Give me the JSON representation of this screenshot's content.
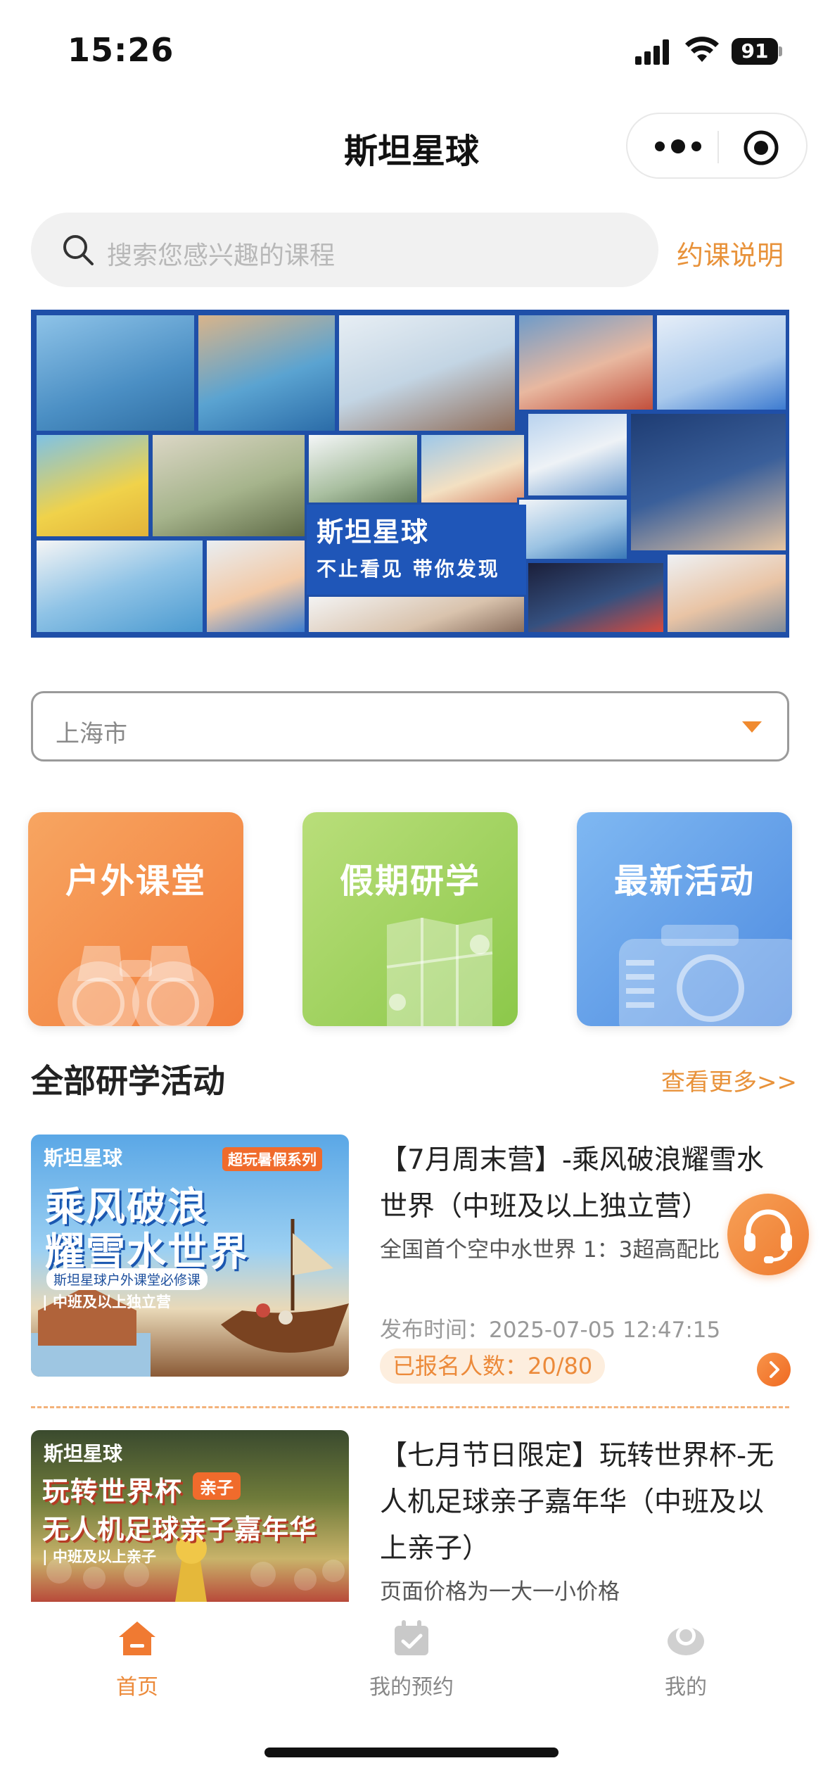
{
  "status_bar": {
    "time": "15:26",
    "battery": "91"
  },
  "nav": {
    "title": "斯坦星球"
  },
  "search": {
    "placeholder": "搜索您感兴趣的课程",
    "booking_link": "约课说明"
  },
  "banner": {
    "brand": "斯坦星球",
    "slogan": "不止看见 带你发现"
  },
  "city": {
    "value": "上海市"
  },
  "categories": [
    {
      "label": "户外课堂",
      "icon": "binoculars-icon",
      "color": "#f27d3b"
    },
    {
      "label": "假期研学",
      "icon": "map-icon",
      "color": "#8cc84a"
    },
    {
      "label": "最新活动",
      "icon": "camera-icon",
      "color": "#4e8be0"
    }
  ],
  "section": {
    "title": "全部研学活动",
    "more": "查看更多>>"
  },
  "items": [
    {
      "title": "【7月周末营】-乘风破浪耀雪水世界（中班及以上独立营）",
      "desc": "全国首个空中水世界 1：3超高配比",
      "date": "发布时间：2025-07-05 12:47:15",
      "badge": "已报名人数：20/80",
      "thumb_brand": "斯坦星球",
      "thumb_series": "超玩暑假系列",
      "thumb_line1": "乘风破浪",
      "thumb_line2": "耀雪水世界",
      "thumb_sub": "斯坦星球户外课堂必修课",
      "thumb_tag": "| 中班及以上独立营"
    },
    {
      "title": "【七月节日限定】玩转世界杯-无人机足球亲子嘉年华（中班及以上亲子）",
      "desc": "页面价格为一大一小价格",
      "thumb_brand": "斯坦星球",
      "thumb_line1": "玩转世界杯",
      "thumb_badge": "亲子",
      "thumb_line2": "无人机足球亲子嘉年华",
      "thumb_tag": "| 中班及以上亲子"
    }
  ],
  "tabs": [
    {
      "label": "首页",
      "icon": "home-icon",
      "active": true
    },
    {
      "label": "我的预约",
      "icon": "calendar-check-icon",
      "active": false
    },
    {
      "label": "我的",
      "icon": "profile-icon",
      "active": false
    }
  ],
  "colors": {
    "accent": "#ec8a3a",
    "banner_blue": "#1f4fa8"
  }
}
